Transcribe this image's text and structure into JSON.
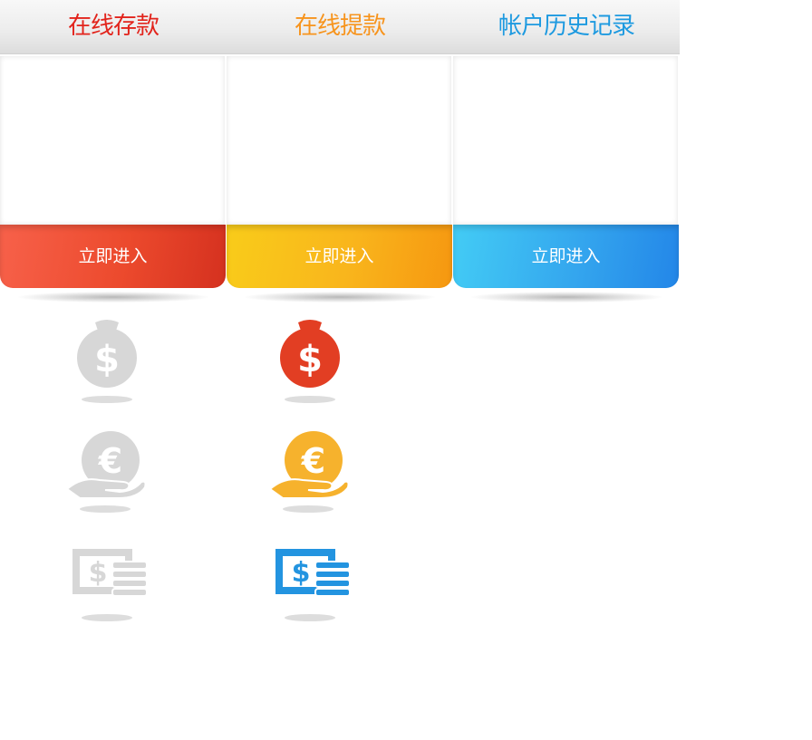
{
  "cards": [
    {
      "title": "在线存款",
      "title_color": "#e2241c",
      "button_label": "立即进入",
      "theme": "red"
    },
    {
      "title": "在线提款",
      "title_color": "#f7941d",
      "button_label": "立即进入",
      "theme": "yellow"
    },
    {
      "title": "帐户历史记录",
      "title_color": "#1e9ae0",
      "button_label": "立即进入",
      "theme": "blue"
    }
  ],
  "icons": {
    "money_bag": [
      "money-bag-icon-inactive",
      "money-bag-icon-active"
    ],
    "euro_hand": [
      "euro-hand-icon-inactive",
      "euro-hand-icon-active"
    ],
    "cash_stack": [
      "cash-stack-icon-inactive",
      "cash-stack-icon-active"
    ]
  },
  "colors": {
    "inactive_icon": "#d7d7d7",
    "money_bag_active": "#e23e23",
    "euro_hand_active": "#f6b22d",
    "cash_stack_active": "#2394e0"
  }
}
